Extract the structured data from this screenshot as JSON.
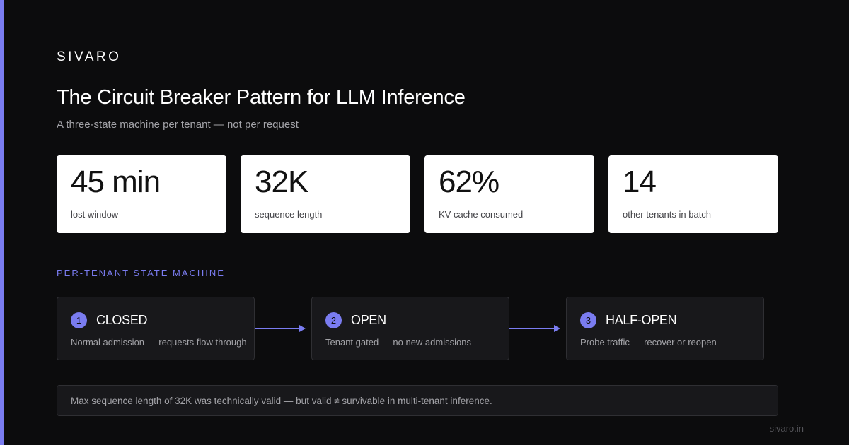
{
  "brand": "SIVARO",
  "title": "The Circuit Breaker Pattern for LLM Inference",
  "subtitle": "A three-state machine per tenant — not per request",
  "stats": [
    {
      "value": "45 min",
      "label": "lost window"
    },
    {
      "value": "32K",
      "label": "sequence length"
    },
    {
      "value": "62%",
      "label": "KV cache consumed"
    },
    {
      "value": "14",
      "label": "other tenants in batch"
    }
  ],
  "section_label": "PER-TENANT STATE MACHINE",
  "states": [
    {
      "number": "1",
      "name": "CLOSED",
      "description": "Normal admission — requests flow through"
    },
    {
      "number": "2",
      "name": "OPEN",
      "description": "Tenant gated — no new admissions"
    },
    {
      "number": "3",
      "name": "HALF-OPEN",
      "description": "Probe traffic — recover or reopen"
    }
  ],
  "note": "Max sequence length of 32K was technically valid — but valid ≠ survivable in multi-tenant inference.",
  "footer": "sivaro.in",
  "colors": {
    "background": "#0c0c0d",
    "accent": "#7a7cf0",
    "card": "#ffffff",
    "panel": "#18181b",
    "muted_text": "#a3a3a8"
  }
}
